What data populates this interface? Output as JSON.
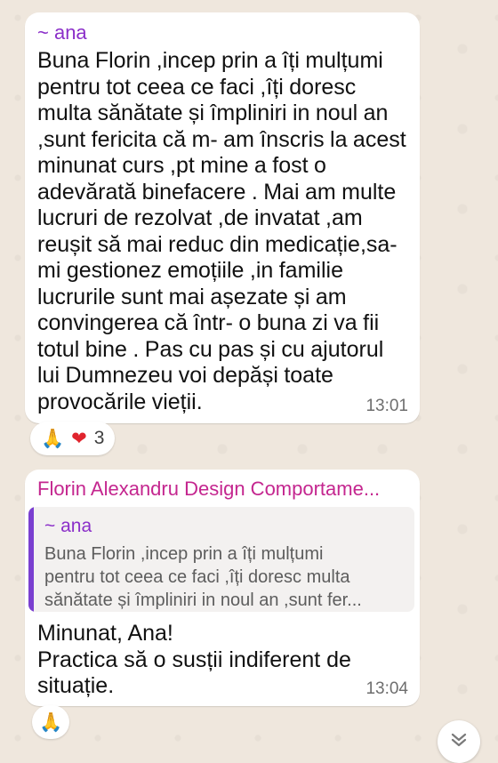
{
  "messages": [
    {
      "sender": "~ ana",
      "text": "Buna Florin ,incep prin a îți mulțumi pentru tot ceea ce faci  ,îți doresc multa sănătate și împliniri in noul an ,sunt fericita că m- am înscris la acest minunat curs  ,pt mine a fost o adevărată  binefacere . Mai am multe lucruri de rezolvat ,de invatat ,am reușit să mai reduc din medicație,sa- mi gestionez emoțiile ,in familie lucrurile  sunt mai așezate și am convingerea că într- o buna zi va fii totul bine . Pas cu pas și cu ajutorul lui Dumnezeu  voi depăși toate provocările vieții.",
      "time": "13:01",
      "reactions": {
        "emojis": [
          "🙏",
          "❤"
        ],
        "count": "3"
      }
    },
    {
      "sender": "Florin Alexandru Design Comportame...",
      "quote": {
        "sender": "~ ana",
        "line1": "Buna Florin ,incep prin a îți mulțumi",
        "line2": "pentru tot ceea ce faci  ,îți doresc multa",
        "line3": "sănătate și împliniri in noul an ,sunt fer..."
      },
      "text": "Minunat, Ana!\nPractica să o susții indiferent de situație.",
      "time": "13:04",
      "reactions": {
        "emojis": [
          "🙏"
        ]
      }
    }
  ],
  "icons": {
    "scroll_down": "chevron-double-down-icon"
  },
  "colors": {
    "chat_background": "#efe7dd",
    "bubble": "#ffffff",
    "sender_ana": "#8b2fc9",
    "sender_florin": "#c4268f",
    "quote_bar": "#7a3fd0",
    "timestamp": "#6e6e6e"
  }
}
